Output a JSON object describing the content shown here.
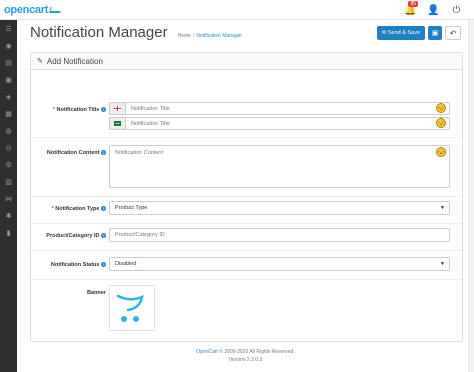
{
  "topbar": {
    "logo_text": "opencart",
    "alert_count": "85"
  },
  "header": {
    "title": "Notification Manager",
    "breadcrumb": [
      "Home",
      "Notification Manager"
    ],
    "buttons": {
      "send_save": "Send & Save"
    }
  },
  "panel": {
    "heading": "Add Notification",
    "fields": {
      "title": {
        "label": "Notification Title",
        "placeholders": [
          "Notification Title",
          "Notification Title"
        ]
      },
      "content": {
        "label": "Notification Content",
        "placeholder": "Notification Content"
      },
      "type": {
        "label": "Notification Type",
        "value": "Product Type"
      },
      "product_id": {
        "label": "Product/Category ID",
        "placeholder": "Product/Category ID"
      },
      "status": {
        "label": "Notification Status",
        "value": "Disabled"
      },
      "banner": {
        "label": "Banner"
      }
    }
  },
  "footer": {
    "link": "OpenCart",
    "copyright": "© 2009-2020 All Rights Reserved.",
    "version": "Version 2.3.0.3"
  },
  "icons": {
    "sidebar": [
      "dashboard-icon",
      "catalog-icon",
      "extension-icon",
      "design-icon",
      "sales-icon",
      "customers-icon",
      "marketing-icon",
      "system-icon",
      "reports-icon",
      "help-icon"
    ]
  },
  "colors": {
    "primary": "#1f7fc2",
    "logo": "#2a9fd6",
    "sidebar": "#2f2f2f",
    "badge": "#e2393a"
  }
}
